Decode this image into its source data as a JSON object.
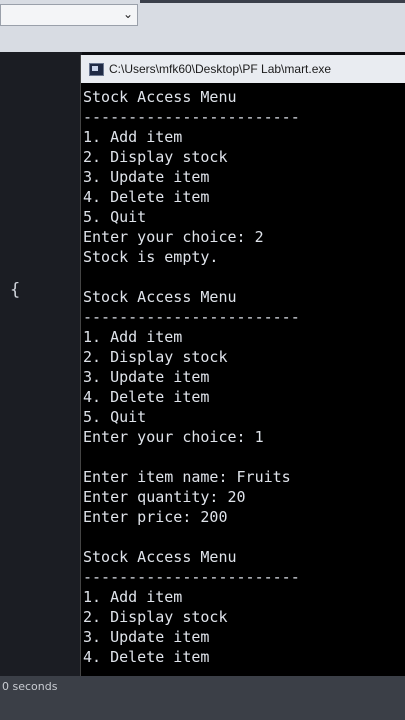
{
  "ide": {
    "dropdown_chevron": "chevron-down-icon",
    "editor_brace": "{",
    "status_text": "0 seconds"
  },
  "console": {
    "title": "C:\\Users\\mfk60\\Desktop\\PF Lab\\mart.exe",
    "lines": [
      "Stock Access Menu",
      "------------------------",
      "1. Add item",
      "2. Display stock",
      "3. Update item",
      "4. Delete item",
      "5. Quit",
      "Enter your choice: 2",
      "Stock is empty.",
      "",
      "Stock Access Menu",
      "------------------------",
      "1. Add item",
      "2. Display stock",
      "3. Update item",
      "4. Delete item",
      "5. Quit",
      "Enter your choice: 1",
      "",
      "Enter item name: Fruits",
      "Enter quantity: 20",
      "Enter price: 200",
      "",
      "Stock Access Menu",
      "------------------------",
      "1. Add item",
      "2. Display stock",
      "3. Update item",
      "4. Delete item"
    ]
  },
  "colors": {
    "console_bg": "#000000",
    "console_text": "#dfe3ea",
    "titlebar_bg": "#e9ecf1"
  }
}
